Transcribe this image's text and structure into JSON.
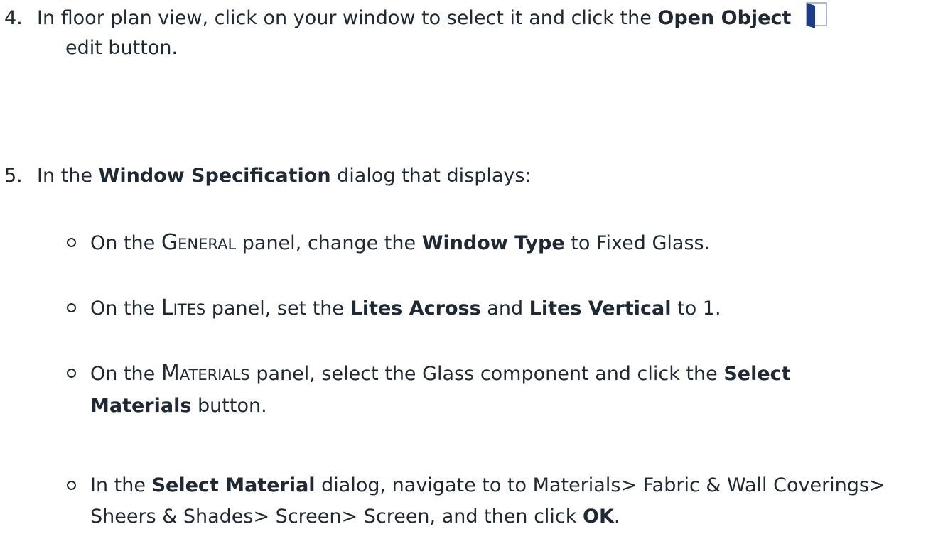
{
  "step4": {
    "number": "4.",
    "text_before": "In floor plan view, click on your window to select it and click the",
    "bold": "Open Object",
    "icon": "open-object-door-icon",
    "text_after": "edit button."
  },
  "step5": {
    "number": "5.",
    "text_before": "In the",
    "bold": "Window Specification",
    "text_after": "dialog that displays:",
    "items": [
      {
        "a": "On the",
        "panel_cap": "G",
        "panel_rest": "ENERAL",
        "b": "panel, change the",
        "bold1": "Window Type",
        "c": "to Fixed Glass."
      },
      {
        "a": "On the",
        "panel_cap": "L",
        "panel_rest": "ITES",
        "b": "panel, set the",
        "bold1": "Lites Across",
        "c": "and",
        "bold2": "Lites Vertical",
        "d": "to 1."
      },
      {
        "a": "On the",
        "panel_cap": "M",
        "panel_rest": "ATERIALS",
        "b": "panel, select the Glass component and click the",
        "bold1": "Select Materials",
        "c": "button."
      },
      {
        "a": "In the",
        "bold1": "Select Material",
        "b": "dialog, navigate to to Materials> Fabric & Wall Coverings> Sheers & Shades> Screen> Screen, and then click",
        "bold2": "OK",
        "c": "."
      }
    ]
  },
  "colors": {
    "text": "#1f2933",
    "icon_dark": "#1e3a8a",
    "icon_light": "#8aa0c8"
  }
}
